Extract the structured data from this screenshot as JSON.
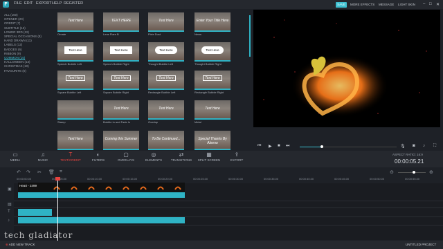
{
  "menu": {
    "file": "FILE",
    "edit": "EDIT",
    "export": "EXPORT",
    "help": "HELP",
    "register": "REGISTER"
  },
  "topright": {
    "save": "SAVE",
    "more_effects": "MORE EFFECTS",
    "message": "MESSAGE",
    "skin": "LIGHT SKIN"
  },
  "categories": [
    "ALL (160)",
    "OPENER (20)",
    "CREDIT (7)",
    "SUBTITLE (13)",
    "LOWER 3RD (22)",
    "SPECIAL OCCASIONS (8)",
    "HAND DRAWN (11)",
    "LABELS (12)",
    "BADGES (6)",
    "RIBBON (9)",
    "COMMON (15)",
    "HALLOWEEN (13)",
    "CHRISTMAS (10)",
    "FAVOURITE (0)"
  ],
  "active_category_index": 10,
  "thumbnails": [
    {
      "label": "Ornate",
      "title": "Text Here"
    },
    {
      "label": "Lens Flare B",
      "title": "TEXT HERE"
    },
    {
      "label": "Pixie Dust",
      "title": "Text Here"
    },
    {
      "label": "News",
      "title": "Enter Your Title Here"
    },
    {
      "label": "Speech Bubble Left",
      "title": "Text Here"
    },
    {
      "label": "Speech Bubble Right",
      "title": "Text Here"
    },
    {
      "label": "Thought Bubble Left",
      "title": "Text Here"
    },
    {
      "label": "Thought Bubble Right",
      "title": "Text Here"
    },
    {
      "label": "Square Bubble Left",
      "title": "Text Here"
    },
    {
      "label": "Square Bubble Right",
      "title": "Text Here"
    },
    {
      "label": "Rectangle Bubble Left",
      "title": "Text Here"
    },
    {
      "label": "Rectangle Bubble Right",
      "title": "Text Here"
    },
    {
      "label": "Stamp",
      "title": ""
    },
    {
      "label": "Bubble in and Fade In",
      "title": "Text Here"
    },
    {
      "label": "Overlap",
      "title": "Text Here"
    },
    {
      "label": "Metal",
      "title": "Text Here"
    },
    {
      "label": "",
      "title": "Text Here"
    },
    {
      "label": "",
      "title": "Coming this Summer"
    },
    {
      "label": "",
      "title": "To Be Continued..."
    },
    {
      "label": "",
      "title": "Special Thanks By Aleeno"
    }
  ],
  "toolbar": [
    {
      "label": "MEDIA",
      "icon": "folder-icon"
    },
    {
      "label": "MUSIC",
      "icon": "music-icon"
    },
    {
      "label": "TEXT/CREDIT",
      "icon": "text-icon"
    },
    {
      "label": "FILTERS",
      "icon": "filters-icon"
    },
    {
      "label": "OVERLAYS",
      "icon": "overlays-icon"
    },
    {
      "label": "ELEMENTS",
      "icon": "elements-icon"
    },
    {
      "label": "TRANSITIONS",
      "icon": "transitions-icon"
    },
    {
      "label": "SPLIT SCREEN",
      "icon": "split-screen-icon"
    },
    {
      "label": "EXPORT",
      "icon": "export-icon"
    }
  ],
  "active_tool_index": 2,
  "aspect_ratio": "ASPECT RATIO: 16:9",
  "timecode": "00:00:05.21",
  "ruler": [
    "00:00:00.00",
    "00:00:05.00",
    "00:00:10.00",
    "00:00:15.00",
    "00:00:20.00",
    "00:00:25.00",
    "00:00:30.00",
    "00:00:35.00",
    "00:00:40.00",
    "00:00:45.00",
    "00:00:50.00",
    "00:00:55.00"
  ],
  "clip_name": "Heart - 2499",
  "playback_progress": 0.23,
  "watermark": "tech gladiator",
  "add_track": "ADD NEW TRACK",
  "project_name": "UNTITLED PROJECT",
  "colors": {
    "accent": "#2fb3c5",
    "active": "#e6433f",
    "background": "#1e2127"
  }
}
